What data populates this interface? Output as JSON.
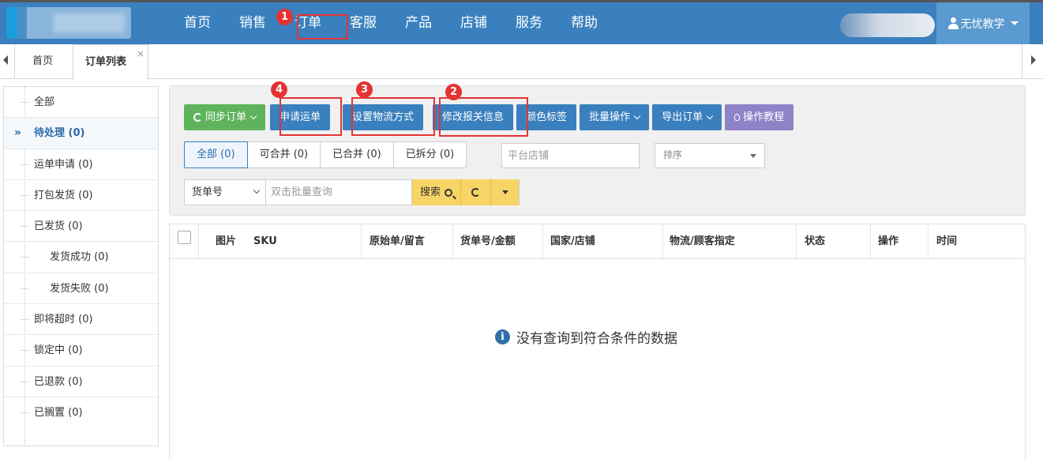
{
  "nav": {
    "items": [
      "首页",
      "销售",
      "订单",
      "客服",
      "产品",
      "店铺",
      "服务",
      "帮助"
    ],
    "active_index": 2,
    "user_label": "无忧教学"
  },
  "tabs": {
    "home": "首页",
    "current": "订单列表",
    "close_symbol": "×"
  },
  "sidebar": {
    "items": [
      {
        "label": "全部",
        "active": false,
        "sub": false
      },
      {
        "label": "待处理 (0)",
        "active": true,
        "sub": false
      },
      {
        "label": "运单申请 (0)",
        "active": false,
        "sub": false
      },
      {
        "label": "打包发货 (0)",
        "active": false,
        "sub": false
      },
      {
        "label": "已发货 (0)",
        "active": false,
        "sub": false
      },
      {
        "label": "发货成功 (0)",
        "active": false,
        "sub": true
      },
      {
        "label": "发货失败 (0)",
        "active": false,
        "sub": true
      },
      {
        "label": "即将超时 (0)",
        "active": false,
        "sub": false
      },
      {
        "label": "锁定中 (0)",
        "active": false,
        "sub": false
      },
      {
        "label": "已退款 (0)",
        "active": false,
        "sub": false
      },
      {
        "label": "已搁置 (0)",
        "active": false,
        "sub": false
      }
    ],
    "active_marker": "»"
  },
  "toolbar": {
    "sync_orders": "同步订单",
    "apply_waybill": "申请运单",
    "set_logistics": "设置物流方式",
    "edit_customs": "修改报关信息",
    "color_tag": "颜色标签",
    "batch_ops": "批量操作",
    "export_orders": "导出订单",
    "tutorial": "操作教程"
  },
  "filters": {
    "segments": [
      "全部 (0)",
      "可合并 (0)",
      "已合并 (0)",
      "已拆分 (0)"
    ],
    "shop_placeholder": "平台店铺",
    "sort_placeholder": "排序"
  },
  "search": {
    "field": "货单号",
    "placeholder": "双击批量查询",
    "button": "搜索"
  },
  "table": {
    "columns": [
      "图片",
      "SKU",
      "原始单/留言",
      "货单号/金额",
      "国家/店铺",
      "物流/顾客指定",
      "状态",
      "操作",
      "时间"
    ],
    "empty_text": "没有查询到符合条件的数据"
  },
  "annotations": [
    "1",
    "2",
    "3",
    "4"
  ],
  "colors": {
    "nav_bg": "#3a80be",
    "primary_button": "#3a80be",
    "green_button": "#5fb35c",
    "purple_button": "#8f83c8",
    "search_button": "#f7d466",
    "annotation_red": "#e53232"
  }
}
